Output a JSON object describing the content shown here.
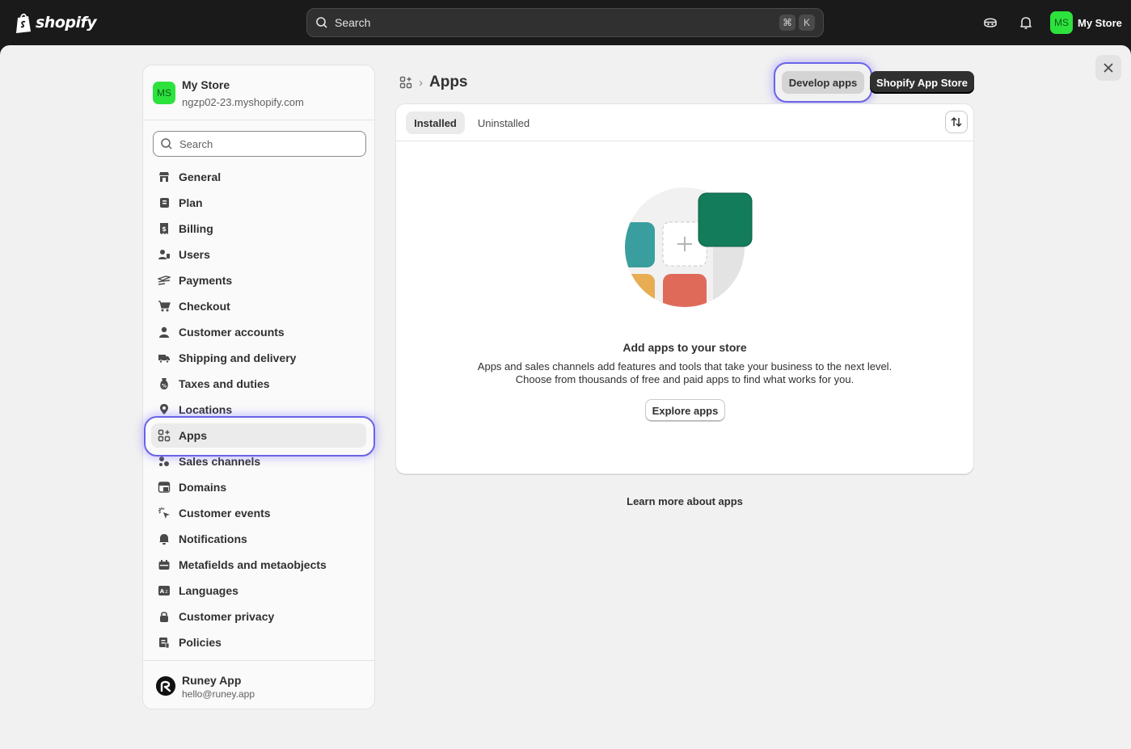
{
  "topbar": {
    "brand": "shopify",
    "search_placeholder": "Search",
    "shortcut_keys": [
      "⌘",
      "K"
    ],
    "store_initials": "MS",
    "store_name": "My Store",
    "icons": [
      "shopify-bag-icon",
      "search-icon",
      "sidekick-icon",
      "bell-icon"
    ]
  },
  "sidebar": {
    "store_initials": "MS",
    "store_name": "My Store",
    "store_domain": "ngzp02-23.myshopify.com",
    "search_placeholder": "Search",
    "active_item": "Apps",
    "items": [
      {
        "label": "General",
        "icon": "store-icon"
      },
      {
        "label": "Plan",
        "icon": "plan-icon"
      },
      {
        "label": "Billing",
        "icon": "billing-icon"
      },
      {
        "label": "Users",
        "icon": "users-icon"
      },
      {
        "label": "Payments",
        "icon": "payments-icon"
      },
      {
        "label": "Checkout",
        "icon": "cart-icon"
      },
      {
        "label": "Customer accounts",
        "icon": "person-icon"
      },
      {
        "label": "Shipping and delivery",
        "icon": "truck-icon"
      },
      {
        "label": "Taxes and duties",
        "icon": "taxes-icon"
      },
      {
        "label": "Locations",
        "icon": "location-pin-icon"
      },
      {
        "label": "Apps",
        "icon": "apps-icon"
      },
      {
        "label": "Sales channels",
        "icon": "sales-channels-icon"
      },
      {
        "label": "Domains",
        "icon": "domains-icon"
      },
      {
        "label": "Customer events",
        "icon": "cursor-click-icon"
      },
      {
        "label": "Notifications",
        "icon": "bell-icon"
      },
      {
        "label": "Metafields and metaobjects",
        "icon": "metafields-icon"
      },
      {
        "label": "Languages",
        "icon": "languages-icon"
      },
      {
        "label": "Customer privacy",
        "icon": "lock-icon"
      },
      {
        "label": "Policies",
        "icon": "policies-icon"
      }
    ],
    "footer": {
      "name": "Runey App",
      "email": "hello@runey.app"
    }
  },
  "page": {
    "title": "Apps",
    "breadcrumb_separator": "›",
    "develop_apps_label": "Develop apps",
    "app_store_label": "Shopify App Store",
    "tabs": [
      "Installed",
      "Uninstalled"
    ],
    "selected_tab": "Installed",
    "empty_state": {
      "title": "Add apps to your store",
      "line1": "Apps and sales channels add features and tools that take your business to the next level.",
      "line2": "Choose from thousands of free and paid apps to find what works for you.",
      "button": "Explore apps"
    },
    "learn_more": "Learn more about apps"
  },
  "colors": {
    "topbar": "#1a1a1a",
    "avatar_green": "#2ee23d",
    "highlight_ring": "#6a63e6",
    "illustration": [
      "#3a9e9e",
      "#137c5b",
      "#e06a5a",
      "#e8ac52"
    ]
  }
}
